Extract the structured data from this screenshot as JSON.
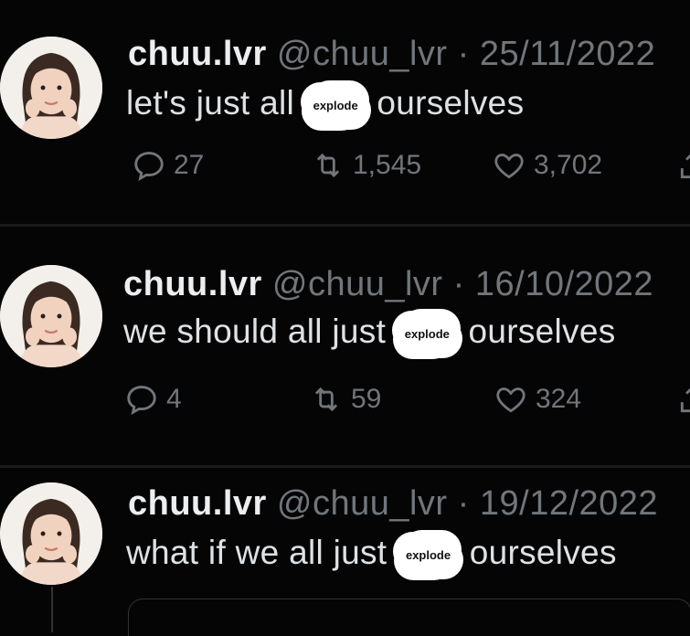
{
  "tweets": [
    {
      "display_name": "chuu.lvr",
      "handle": "@chuu_lvr",
      "separator": "·",
      "date": "25/11/2022",
      "text_before": "let's just all",
      "sticker": "explode",
      "text_after": "ourselves",
      "replies": "27",
      "retweets": "1,545",
      "likes": "3,702"
    },
    {
      "display_name": "chuu.lvr",
      "handle": "@chuu_lvr",
      "separator": "·",
      "date": "16/10/2022",
      "text_before": "we should all just",
      "sticker": "explode",
      "text_after": "ourselves",
      "replies": "4",
      "retweets": "59",
      "likes": "324"
    },
    {
      "display_name": "chuu.lvr",
      "handle": "@chuu_lvr",
      "separator": "·",
      "date": "19/12/2022",
      "text_before": "what if we all just",
      "sticker": "explode",
      "text_after": "ourselves"
    }
  ],
  "icons": {
    "reply": "comment-icon",
    "retweet": "retweet-icon",
    "like": "heart-icon",
    "share": "share-icon"
  },
  "colors": {
    "background": "#050505",
    "text": "#e7e9ea",
    "muted": "#71767b",
    "sticker": "#ffffff"
  }
}
